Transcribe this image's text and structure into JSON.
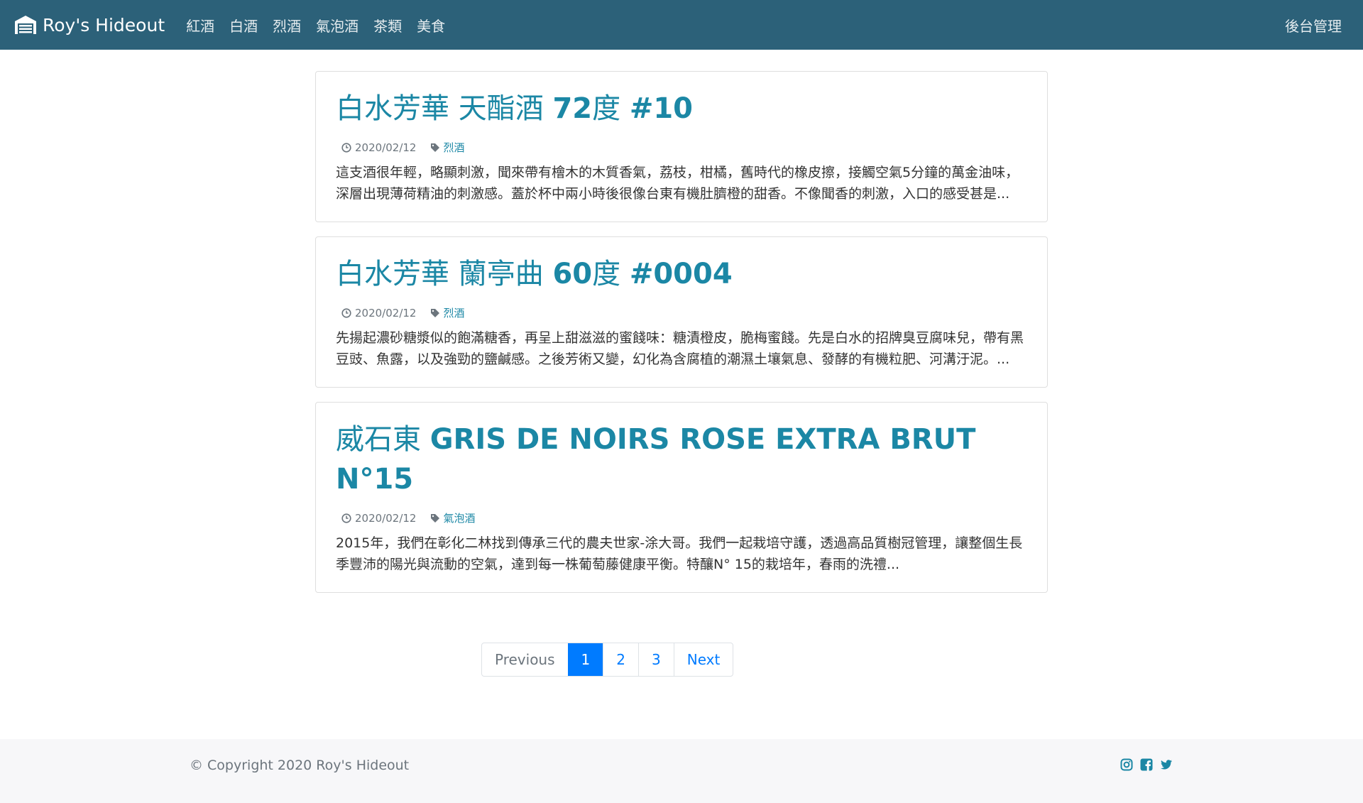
{
  "nav": {
    "brand": "Roy's Hideout",
    "brand_icon": "warehouse-icon",
    "links": [
      "紅酒",
      "白酒",
      "烈酒",
      "氣泡酒",
      "茶類",
      "美食"
    ],
    "admin": "後台管理",
    "bg_color": "#2c6179"
  },
  "posts": [
    {
      "title_main": "白水芳華 天酯酒 ",
      "title_bold": "72",
      "title_rest": "度 ",
      "title_tail": "#10",
      "date": "2020/02/12",
      "category": "烈酒",
      "excerpt": "這支酒很年輕，略顯刺激，聞來帶有檜木的木質香氣，荔枝，柑橘，舊時代的橡皮擦，接觸空氣5分鐘的萬金油味，深層出現薄荷精油的刺激感。蓋於杯中兩小時後很像台東有機肚臍橙的甜香。不像聞香的刺激，入口的感受甚是..."
    },
    {
      "title_main": "白水芳華 蘭亭曲 ",
      "title_bold": "60",
      "title_rest": "度 ",
      "title_tail": "#0004",
      "date": "2020/02/12",
      "category": "烈酒",
      "excerpt": "先揚起濃砂糖漿似的飽滿糖香，再呈上甜滋滋的蜜餞味：糖漬橙皮，脆梅蜜餞。先是白水的招牌臭豆腐味兒，帶有黑豆豉、魚露，以及強勁的鹽鹹感。之後芳術又變，幻化為含腐植的潮濕土壤氣息、發酵的有機粒肥、河溝汙泥。..."
    },
    {
      "title_main": "威石東 ",
      "title_bold": "GRIS DE NOIRS ROSE EXTRA BRUT N°15",
      "title_rest": "",
      "title_tail": "",
      "date": "2020/02/12",
      "category": "氣泡酒",
      "excerpt": "2015年，我們在彰化二林找到傳承三代的農夫世家-涂大哥。我們一起栽培守護，透過高品質樹冠管理，讓整個生長季豐沛的陽光與流動的空氣，達到每一株葡萄藤健康平衡。特釀N° 15的栽培年，春雨的洗禮..."
    }
  ],
  "pagination": {
    "previous": "Previous",
    "pages": [
      "1",
      "2",
      "3"
    ],
    "next": "Next",
    "active": "1"
  },
  "footer": {
    "copyright": "© Copyright 2020 Roy's Hideout",
    "social_icons": [
      "instagram-icon",
      "facebook-icon",
      "twitter-icon"
    ],
    "icon_color": "#1b87a5"
  }
}
